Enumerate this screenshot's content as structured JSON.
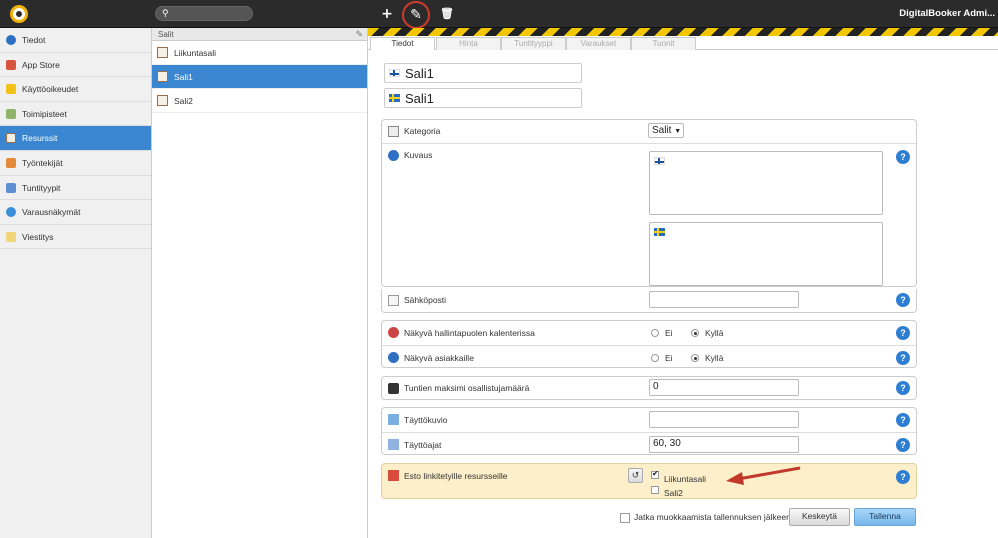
{
  "app": {
    "user": "DigitalBooker Admi..."
  },
  "toolbar": {
    "add": "+",
    "edit": "✎",
    "delete": "🗑"
  },
  "nav": [
    "Tiedot",
    "App Store",
    "Käyttöoikeudet",
    "Toimipisteet",
    "Resurssit",
    "Työntekijät",
    "Tuntityypit",
    "Varausnäkymät",
    "Viestitys"
  ],
  "list": {
    "header": "Salit",
    "items": [
      "Liikuntasali",
      "Sali1",
      "Sali2"
    ]
  },
  "tabs": [
    "Tiedot",
    "Hinta",
    "Tuntityyppi",
    "Varaukset",
    "Tunnit"
  ],
  "names": {
    "fi": "Sali1",
    "sv": "Sali1"
  },
  "form": {
    "kategoria_label": "Kategoria",
    "kategoria_value": "Salit",
    "kuvaus_label": "Kuvaus",
    "email_label": "Sähköposti",
    "show_admin_label": "Näkyvä hallintapuolen kalenterissa",
    "show_customers_label": "Näkyvä asiakkaille",
    "ei": "Ei",
    "kylla": "Kyllä",
    "max_label": "Tuntien maksimi osallistujamäärä",
    "max_value": "0",
    "pattern_label": "Täyttökuvio",
    "pattern_value": "",
    "times_label": "Täyttöajat",
    "times_value": "60, 30",
    "block_label": "Esto linkitetyille resursseille",
    "block_items": [
      "Liikuntasali",
      "Sali2"
    ],
    "continue_label": "Jatka muokkaamista tallennuksen jälkeen",
    "cancel": "Keskeytä",
    "save": "Tallenna"
  }
}
